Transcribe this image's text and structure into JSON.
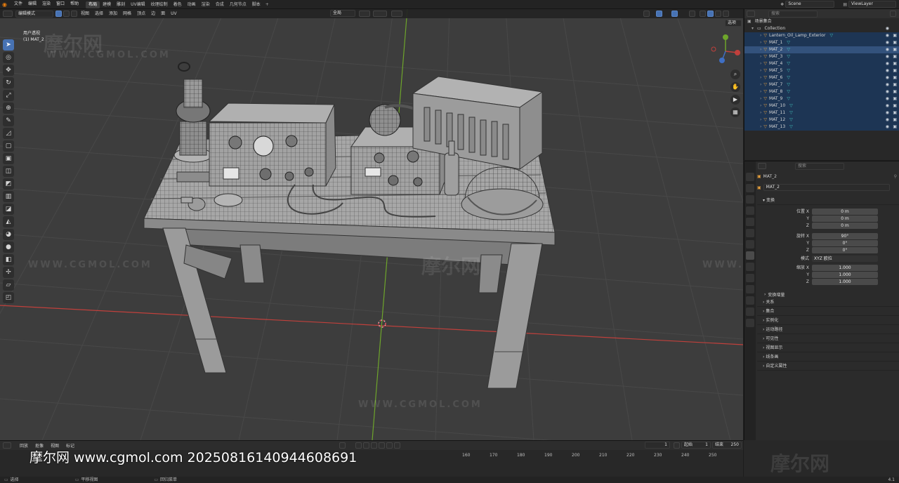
{
  "menu": {
    "items": [
      "文件",
      "编辑",
      "渲染",
      "窗口",
      "帮助"
    ],
    "workspaces": [
      "布局",
      "建模",
      "雕刻",
      "UV编辑",
      "纹理绘制",
      "着色",
      "动画",
      "渲染",
      "合成",
      "几何节点",
      "脚本"
    ],
    "scene_label": "Scene",
    "viewlayer_label": "ViewLayer"
  },
  "viewport": {
    "mode": "编辑模式",
    "menus": [
      "视图",
      "选择",
      "添加",
      "网格",
      "顶点",
      "边",
      "面",
      "UV"
    ],
    "transform_orientation": "全局",
    "options": "选项",
    "view_title": "用户透视",
    "object_name": "(1) MAT_2"
  },
  "watermark": {
    "brand_cn": "摩尔网",
    "brand_en": "WWW.CGMOL.COM",
    "footer_text": "摩尔网 www.cgmol.com 20250816140944608691"
  },
  "outliner": {
    "search_placeholder": "搜索",
    "scene_collection": "场景集合",
    "collection": "Collection",
    "items": [
      {
        "name": "Lantern_Oil_Lamp_Exterior",
        "selected": true,
        "active": false
      },
      {
        "name": "MAT_1",
        "selected": true,
        "active": false
      },
      {
        "name": "MAT_2",
        "selected": true,
        "active": true
      },
      {
        "name": "MAT_3",
        "selected": true,
        "active": false
      },
      {
        "name": "MAT_4",
        "selected": true,
        "active": false
      },
      {
        "name": "MAT_5",
        "selected": true,
        "active": false
      },
      {
        "name": "MAT_6",
        "selected": true,
        "active": false
      },
      {
        "name": "MAT_7",
        "selected": true,
        "active": false
      },
      {
        "name": "MAT_8",
        "selected": true,
        "active": false
      },
      {
        "name": "MAT_9",
        "selected": true,
        "active": false
      },
      {
        "name": "MAT_10",
        "selected": true,
        "active": false
      },
      {
        "name": "MAT_11",
        "selected": true,
        "active": false
      },
      {
        "name": "MAT_12",
        "selected": true,
        "active": false
      },
      {
        "name": "MAT_13",
        "selected": true,
        "active": false
      }
    ]
  },
  "properties": {
    "search_placeholder": "搜索",
    "object_name": "MAT_2",
    "object_field": "MAT_2",
    "transform_header": "变换",
    "location_label": "位置 X",
    "rotation_label": "旋转 X",
    "scale_label": "缩放 X",
    "axis_y": "Y",
    "axis_z": "Z",
    "location": [
      "0 m",
      "0 m",
      "0 m"
    ],
    "rotation": [
      "90°",
      "0°",
      "0°"
    ],
    "mode_label": "模式",
    "mode_value": "XYZ 欧拉",
    "scale": [
      "1.000",
      "1.000",
      "1.000"
    ],
    "delta_transform": "变换增量",
    "panels": [
      "关系",
      "集合",
      "实例化",
      "运动路径",
      "可见性",
      "视图显示",
      "线条画",
      "自定义属性"
    ]
  },
  "timeline": {
    "menus": [
      "回放",
      "抠像",
      "视图",
      "标记"
    ],
    "current_frame": "1",
    "start_label": "起始",
    "start_value": "1",
    "end_label": "结束",
    "end_value": "250",
    "ticks": [
      "160",
      "170",
      "180",
      "190",
      "200",
      "210",
      "220",
      "230",
      "240",
      "250"
    ]
  },
  "status": {
    "left": "选择",
    "middle": "平移视图",
    "right": "回归菜单",
    "version": "4.1"
  },
  "colors": {
    "accent_blue": "#4772b3",
    "viewport_bg": "#3d3d3d",
    "x_axis": "#c1403c",
    "y_axis": "#6ea52b",
    "selected_row": "#1d3554",
    "object_orange": "#e7a03c",
    "mesh_teal": "#42c4bd"
  }
}
